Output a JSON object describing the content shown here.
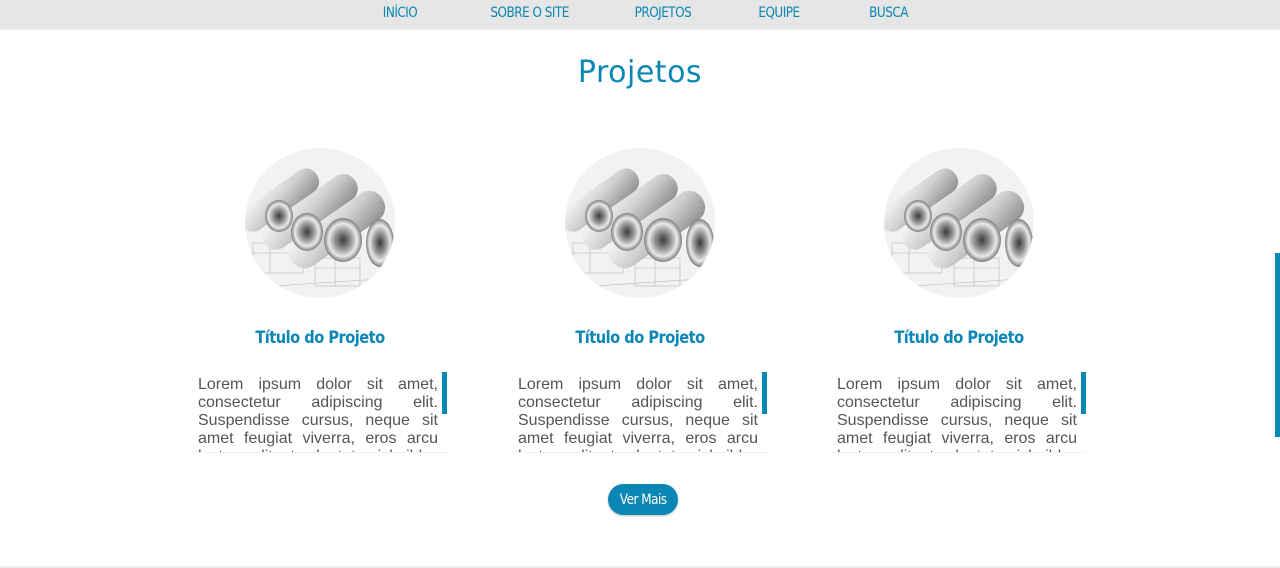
{
  "nav": {
    "items": [
      {
        "label": "INÍCIO"
      },
      {
        "label": "SOBRE O SITE"
      },
      {
        "label": "PROJETOS"
      },
      {
        "label": "EQUIPE"
      },
      {
        "label": "BUSCA"
      }
    ]
  },
  "main": {
    "title": "Projetos",
    "projects": [
      {
        "image": "rolled-blueprints-photo",
        "title": "Título do Projeto",
        "text": "Lorem ipsum dolor sit amet, consectetur adipiscing elit. Suspendisse cursus, neque sit amet feugiat viverra, eros arcu luctus velit, at vulputate nisl nibh"
      },
      {
        "image": "rolled-blueprints-photo",
        "title": "Título do Projeto",
        "text": "Lorem ipsum dolor sit amet, consectetur adipiscing elit. Suspendisse cursus, neque sit amet feugiat viverra, eros arcu luctus velit, at vulputate nisl nibh"
      },
      {
        "image": "rolled-blueprints-photo",
        "title": "Título do Projeto",
        "text": "Lorem ipsum dolor sit amet, consectetur adipiscing elit. Suspendisse cursus, neque sit amet feugiat viverra, eros arcu luctus velit, at vulputate nisl nibh"
      }
    ],
    "more_label": "Ver Mais"
  },
  "colors": {
    "accent": "#0a87b4",
    "nav_bg": "#e6e6e6",
    "body_text": "#555555"
  }
}
